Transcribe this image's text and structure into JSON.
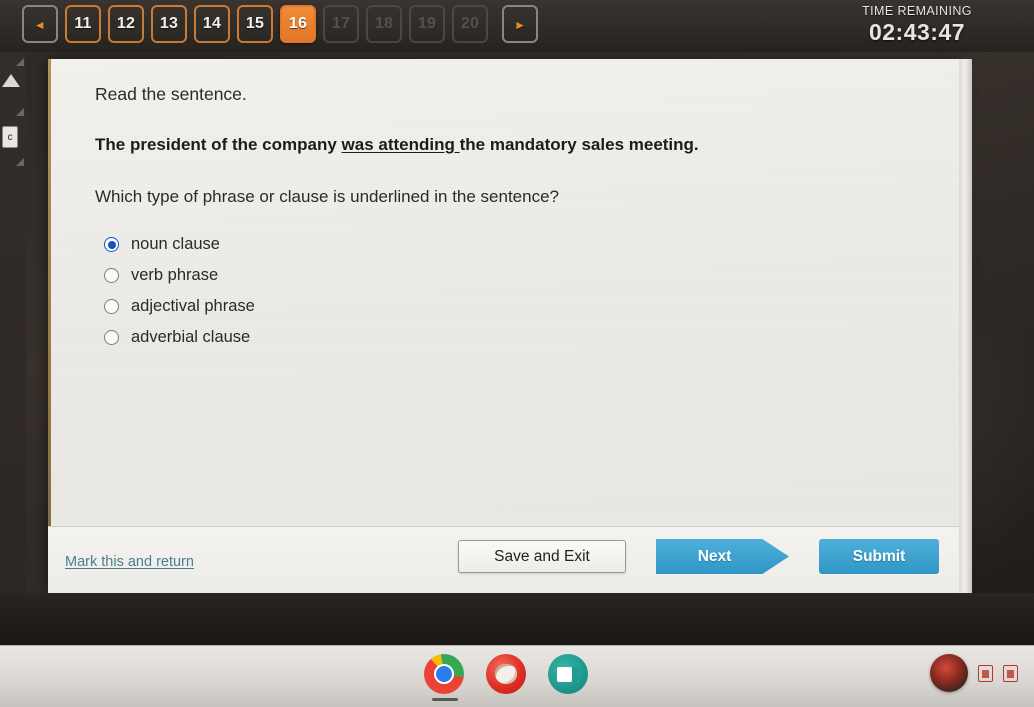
{
  "topbar": {
    "prev_arrow": "◂",
    "next_arrow": "▸",
    "questions": [
      {
        "label": "11",
        "state": "available"
      },
      {
        "label": "12",
        "state": "available"
      },
      {
        "label": "13",
        "state": "available"
      },
      {
        "label": "14",
        "state": "available"
      },
      {
        "label": "15",
        "state": "available"
      },
      {
        "label": "16",
        "state": "current"
      },
      {
        "label": "17",
        "state": "disabled"
      },
      {
        "label": "18",
        "state": "disabled"
      },
      {
        "label": "19",
        "state": "disabled"
      },
      {
        "label": "20",
        "state": "disabled"
      }
    ],
    "timer_label": "TIME REMAINING",
    "timer_value": "02:43:47",
    "accent_color": "#e2762a",
    "disabled_color": "#57504a"
  },
  "question": {
    "intro": "Read the sentence.",
    "sentence_before": "The president of the company ",
    "sentence_underlined": "was attending ",
    "sentence_after": "the mandatory sales meeting.",
    "prompt": "Which type of phrase or clause is underlined in the sentence?",
    "options": [
      {
        "label": "noun clause",
        "selected": true
      },
      {
        "label": "verb phrase",
        "selected": false
      },
      {
        "label": "adjectival phrase",
        "selected": false
      },
      {
        "label": "adverbial clause",
        "selected": false
      }
    ],
    "selected_radio_color": "#1552c4"
  },
  "footer": {
    "mark_link": "Mark this and return",
    "save_exit": "Save and Exit",
    "next": "Next",
    "submit": "Submit",
    "button_color": "#2f96c6",
    "link_color": "#4b7f90"
  },
  "rail": {
    "chip_label": "c"
  },
  "shelf": {
    "icons": [
      {
        "name": "chrome-icon"
      },
      {
        "name": "red-app-icon"
      },
      {
        "name": "teal-app-icon"
      }
    ],
    "right_icons": [
      {
        "name": "avatar-icon"
      },
      {
        "name": "notification-badge-icon"
      },
      {
        "name": "notification-badge-icon-2"
      }
    ]
  }
}
